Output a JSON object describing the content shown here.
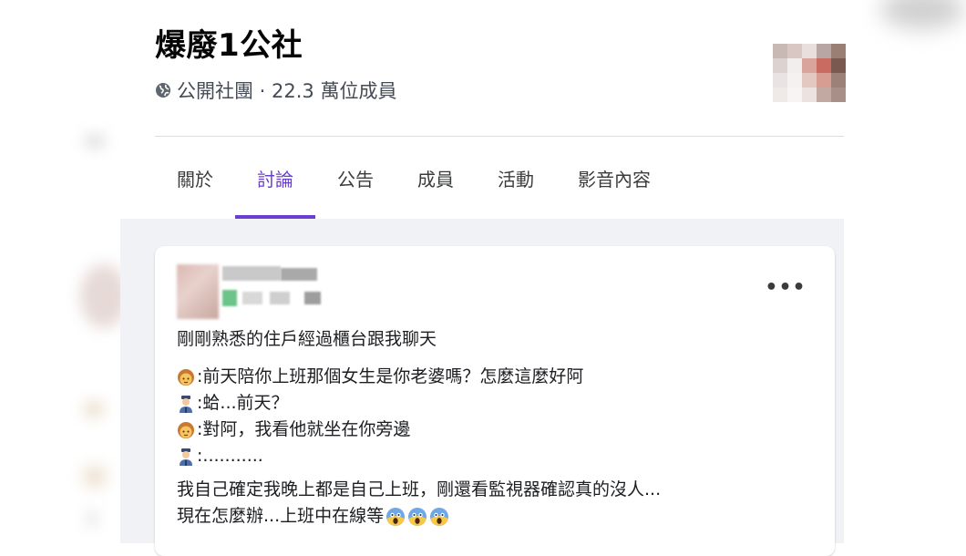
{
  "group": {
    "title": "爆廢1公社",
    "meta": "公開社團 · 22.3 萬位成員",
    "privacy_icon": "globe-icon"
  },
  "tabs": [
    {
      "label": "關於",
      "active": false
    },
    {
      "label": "討論",
      "active": true
    },
    {
      "label": "公告",
      "active": false
    },
    {
      "label": "成員",
      "active": false
    },
    {
      "label": "活動",
      "active": false
    },
    {
      "label": "影音內容",
      "active": false
    }
  ],
  "post": {
    "more_label": "•••",
    "intro": "剛剛熟悉的住戶經過櫃台跟我聊天",
    "dialogue": [
      {
        "speaker_icon": "woman-emoji-icon",
        "text": ":前天陪你上班那個女生是你老婆嗎？怎麼這麼好阿"
      },
      {
        "speaker_icon": "guard-emoji-icon",
        "text": ":蛤...前天？"
      },
      {
        "speaker_icon": "woman-emoji-icon",
        "text": ":對阿，我看他就坐在你旁邊"
      },
      {
        "speaker_icon": "guard-emoji-icon",
        "text": ":..........."
      }
    ],
    "closing_1": "我自己確定我晚上都是自己上班，剛還看監視器確認真的沒人...",
    "closing_2": "現在怎麼辦...上班中在線等",
    "trailing_icons": [
      "face-screaming-icon",
      "face-screaming-icon",
      "face-screaming-icon"
    ]
  },
  "colors": {
    "accent": "#6a3fd0",
    "feed_background": "#f0f2f5",
    "meta_text": "#444b55"
  }
}
